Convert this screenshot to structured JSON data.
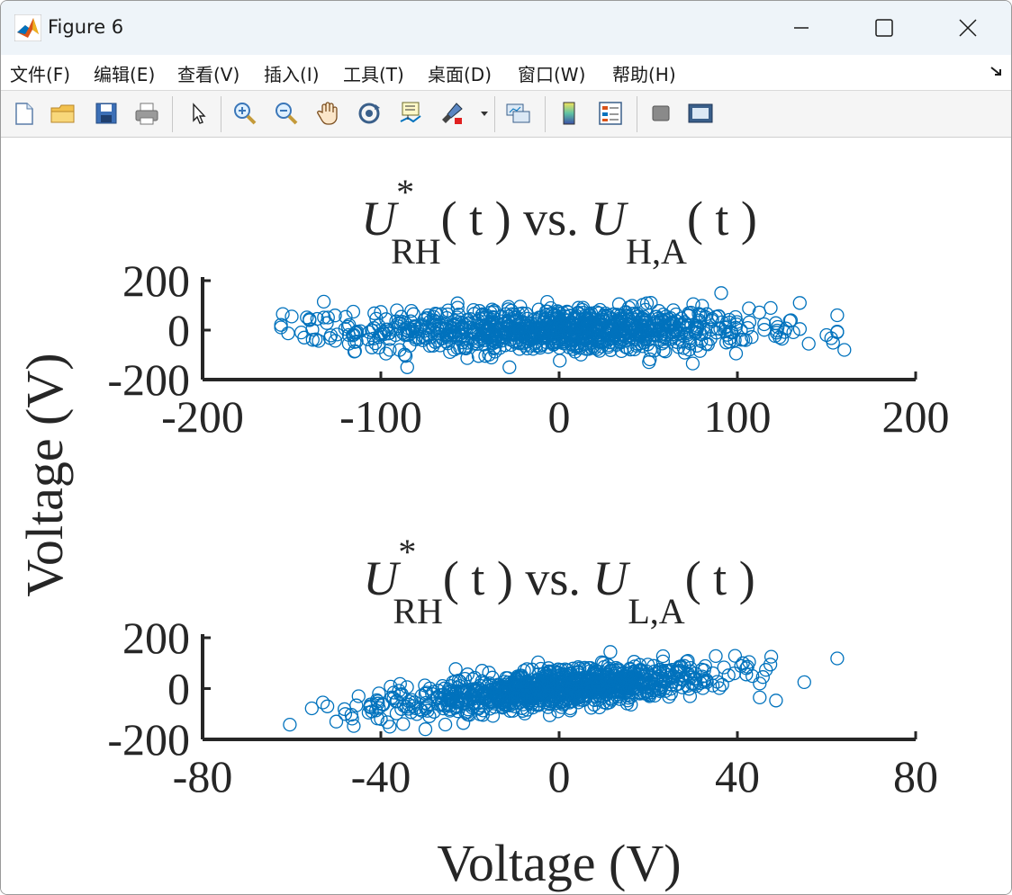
{
  "window": {
    "title": "Figure 6",
    "menu": [
      "文件(F)",
      "编辑(E)",
      "查看(V)",
      "插入(I)",
      "工具(T)",
      "桌面(D)",
      "窗口(W)",
      "帮助(H)"
    ],
    "toolbar_icons": [
      "new-file-icon",
      "open-folder-icon",
      "save-icon",
      "print-icon",
      "pointer-icon",
      "zoom-in-icon",
      "zoom-out-icon",
      "pan-hand-icon",
      "rotate-3d-icon",
      "data-cursor-icon",
      "brush-icon",
      "link-plot-icon",
      "colorbar-icon",
      "legend-icon",
      "hide-plot-tools-icon",
      "show-plot-tools-icon"
    ]
  },
  "figure": {
    "ylabel": "Voltage (V)",
    "xlabel": "Voltage (V)"
  },
  "chart_data": [
    {
      "type": "scatter",
      "title": "U*RH( t ) vs. UH,A( t )",
      "title_parts": {
        "base1": "U",
        "sup1": "*",
        "sub1": "RH",
        "mid": "( t ) vs. ",
        "base2": "U",
        "sub2": "H,A",
        "end": "( t )"
      },
      "xlim": [
        -200,
        200
      ],
      "ylim": [
        -200,
        200
      ],
      "xticks": [
        "-200",
        "-100",
        "0",
        "100",
        "200"
      ],
      "yticks": [
        "-200",
        "0",
        "200"
      ],
      "marker_color": "#0072bd",
      "marker": "open-circle",
      "n_points": 1000,
      "x_std": 55,
      "y_std": 45,
      "correlation": 0.0,
      "outliers": [
        [
          -155,
          65
        ],
        [
          -150,
          55
        ],
        [
          -140,
          40
        ],
        [
          -132,
          115
        ],
        [
          -143,
          -30
        ],
        [
          -120,
          5
        ],
        [
          -118,
          -55
        ],
        [
          -105,
          -70
        ],
        [
          -95,
          -80
        ],
        [
          135,
          110
        ],
        [
          130,
          40
        ],
        [
          140,
          -55
        ],
        [
          150,
          -20
        ],
        [
          160,
          -80
        ],
        [
          125,
          -35
        ]
      ]
    },
    {
      "type": "scatter",
      "title": "U*RH( t ) vs. UL,A( t )",
      "title_parts": {
        "base1": "U",
        "sup1": "*",
        "sub1": "RH",
        "mid": "( t ) vs. ",
        "base2": "U",
        "sub2": "L,A",
        "end": "( t )"
      },
      "xlim": [
        -80,
        80
      ],
      "ylim": [
        -200,
        200
      ],
      "xticks": [
        "-80",
        "-40",
        "0",
        "40",
        "80"
      ],
      "yticks": [
        "-200",
        "0",
        "200"
      ],
      "marker_color": "#0072bd",
      "marker": "open-circle",
      "n_points": 1000,
      "x_std": 18,
      "y_std": 45,
      "correlation": 0.6,
      "outliers": [
        [
          -53,
          -55
        ],
        [
          -52,
          -70
        ],
        [
          -50,
          -130
        ],
        [
          -48,
          -100
        ],
        [
          -45,
          -30
        ],
        [
          -42,
          -90
        ],
        [
          -40,
          -120
        ],
        [
          -38,
          -150
        ],
        [
          -35,
          -140
        ],
        [
          -30,
          -160
        ],
        [
          45,
          20
        ],
        [
          45,
          -35
        ],
        [
          55,
          25
        ],
        [
          42,
          80
        ]
      ]
    }
  ]
}
